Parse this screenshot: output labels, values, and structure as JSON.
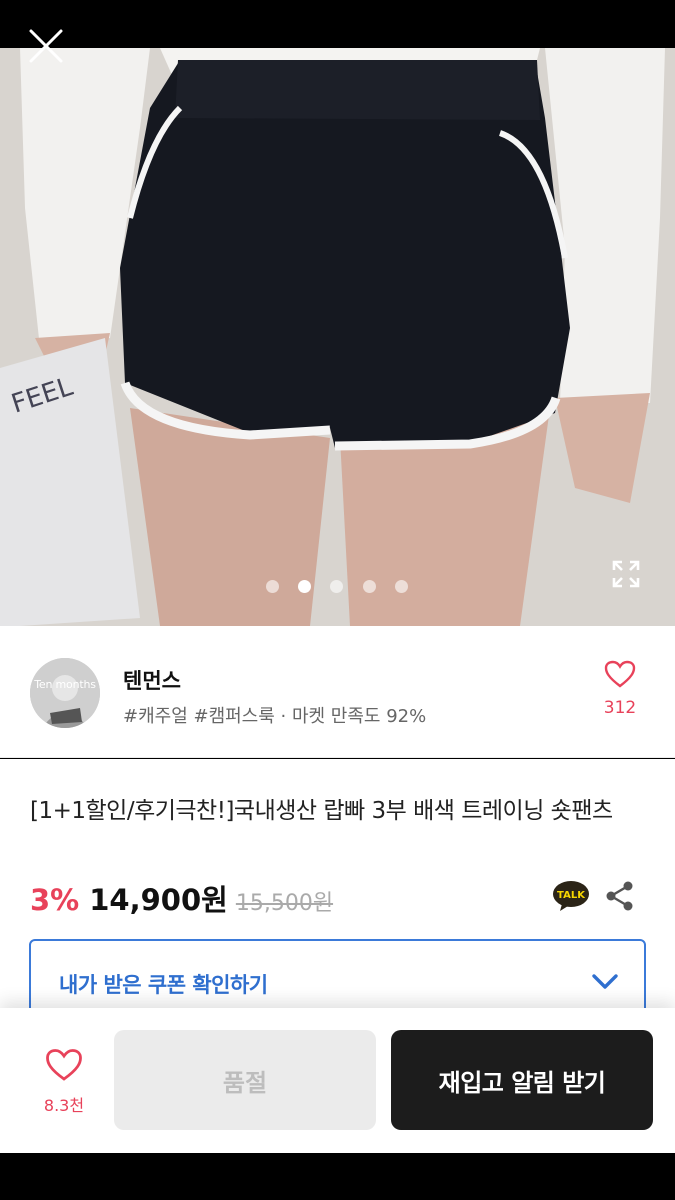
{
  "gallery": {
    "slide_count": 5,
    "active_slide": 2,
    "close_icon": "close-icon",
    "expand_icon": "fullscreen-expand-icon"
  },
  "seller": {
    "avatar_text": "Ten months",
    "name": "텐먼스",
    "tags": "#캐주얼 #캠퍼스룩 · 마켓 만족도 92%",
    "like_icon": "heart-icon",
    "like_count": "312"
  },
  "product": {
    "title": "[1+1할인/후기극찬!]국내생산 랍빠 3부 배색 트레이닝 숏팬츠",
    "discount": "3%",
    "price": "14,900원",
    "original_price": "15,500원",
    "talk_label": "TALK",
    "share_icon": "share-icon"
  },
  "coupon": {
    "label": "내가 받은 쿠폰 확인하기",
    "chevron_icon": "chevron-down-icon"
  },
  "bottom_bar": {
    "wish_icon": "heart-icon",
    "wish_count": "8.3천",
    "soldout_label": "품절",
    "restock_label": "재입고 알림 받기"
  },
  "colors": {
    "accent_red": "#e8425a",
    "coupon_blue": "#2f6fcf",
    "dark_button": "#1c1c1c"
  }
}
